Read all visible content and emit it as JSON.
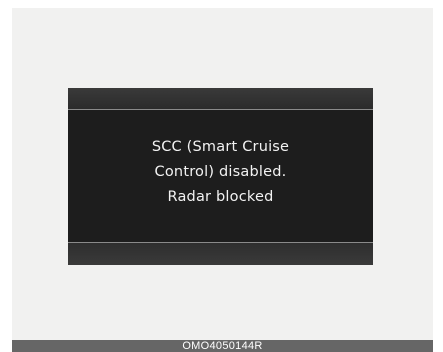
{
  "display": {
    "message_lines": [
      "SCC (Smart Cruise",
      "Control) disabled.",
      "Radar blocked"
    ]
  },
  "caption": {
    "code": "OMO4050144R"
  }
}
